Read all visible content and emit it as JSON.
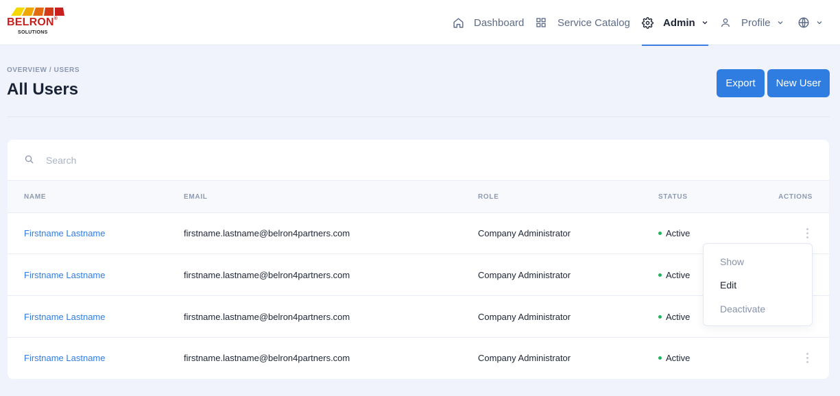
{
  "brand": {
    "name": "BELRON",
    "registered": "®",
    "subtitle": "SOLUTIONS",
    "stripe_colors": [
      "#f5d800",
      "#f0a800",
      "#e46a10",
      "#d23a1a",
      "#c8201e"
    ]
  },
  "nav": {
    "items": [
      {
        "label": "Dashboard",
        "icon": "home-icon"
      },
      {
        "label": "Service Catalog",
        "icon": "grid-icon"
      },
      {
        "label": "Admin",
        "icon": "gear-icon",
        "active": true,
        "dropdown": true
      },
      {
        "label": "Profile",
        "icon": "user-icon",
        "dropdown": true
      },
      {
        "label": "",
        "icon": "globe-icon",
        "dropdown": true
      }
    ]
  },
  "page": {
    "breadcrumb": "OVERVIEW / USERS",
    "title": "All Users",
    "export_label": "Export",
    "new_user_label": "New User"
  },
  "search": {
    "placeholder": "Search",
    "value": ""
  },
  "table": {
    "columns": [
      "NAME",
      "EMAIL",
      "ROLE",
      "STATUS",
      "ACTIONS"
    ],
    "rows": [
      {
        "name": "Firstname Lastname",
        "email": "firstname.lastname@belron4partners.com",
        "role": "Company Administrator",
        "status": "Active"
      },
      {
        "name": "Firstname Lastname",
        "email": "firstname.lastname@belron4partners.com",
        "role": "Company Administrator",
        "status": "Active"
      },
      {
        "name": "Firstname Lastname",
        "email": "firstname.lastname@belron4partners.com",
        "role": "Company Administrator",
        "status": "Active"
      },
      {
        "name": "Firstname Lastname",
        "email": "firstname.lastname@belron4partners.com",
        "role": "Company Administrator",
        "status": "Active"
      }
    ]
  },
  "actions_menu": {
    "items": [
      "Show",
      "Edit",
      "Deactivate"
    ]
  },
  "colors": {
    "accent": "#2f7de1",
    "status_active": "#22b35e",
    "background": "#f0f3fc"
  }
}
